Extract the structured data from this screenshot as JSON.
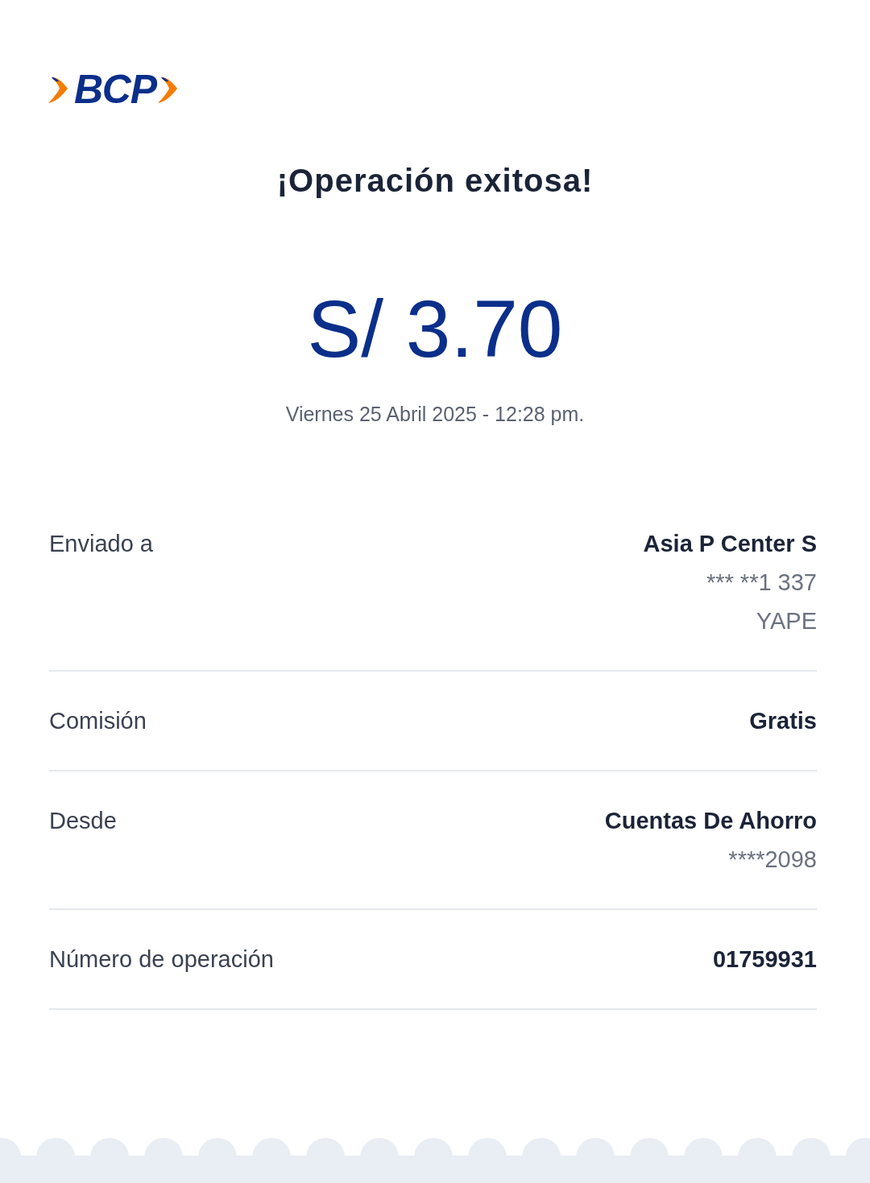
{
  "logo": {
    "text": "BCP"
  },
  "title": "¡Operación exitosa!",
  "amount": "S/ 3.70",
  "datetime": "Viernes 25 Abril 2025 - 12:28 pm.",
  "details": [
    {
      "label": "Enviado a",
      "values": [
        {
          "text": "Asia P Center S",
          "kind": "primary"
        },
        {
          "text": "*** **1 337",
          "kind": "secondary"
        },
        {
          "text": "YAPE",
          "kind": "secondary"
        }
      ]
    },
    {
      "label": "Comisión",
      "values": [
        {
          "text": "Gratis",
          "kind": "primary"
        }
      ]
    },
    {
      "label": "Desde",
      "values": [
        {
          "text": "Cuentas De Ahorro",
          "kind": "primary"
        },
        {
          "text": "****2098",
          "kind": "secondary"
        }
      ]
    },
    {
      "label": "Número de operación",
      "values": [
        {
          "text": "01759931",
          "kind": "primary"
        }
      ]
    }
  ]
}
